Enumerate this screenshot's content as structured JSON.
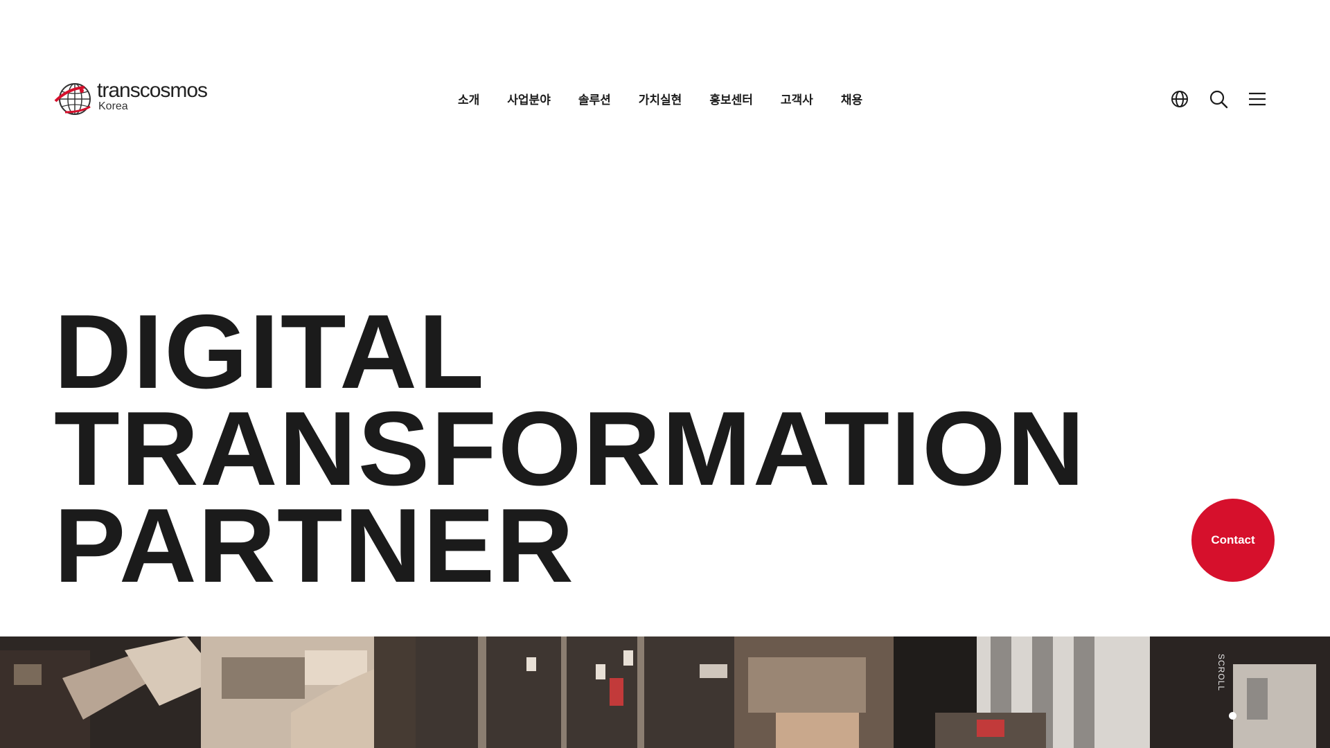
{
  "header": {
    "logo": {
      "name": "transcosmos",
      "sub": "Korea",
      "brand_color": "#d6102c"
    },
    "nav": [
      {
        "label": "소개"
      },
      {
        "label": "사업분야"
      },
      {
        "label": "솔루션"
      },
      {
        "label": "가치실현"
      },
      {
        "label": "홍보센터"
      },
      {
        "label": "고객사"
      },
      {
        "label": "채용"
      }
    ],
    "utilities": [
      {
        "icon": "globe-icon"
      },
      {
        "icon": "search-icon"
      },
      {
        "icon": "menu-icon"
      }
    ]
  },
  "hero": {
    "headline": [
      "DIGITAL",
      "TRANSFORMATION",
      "PARTNER"
    ],
    "contact_label": "Contact",
    "scroll_label": "SCROLL",
    "accent": "#d6102c",
    "text_color": "#1b1b1b"
  }
}
